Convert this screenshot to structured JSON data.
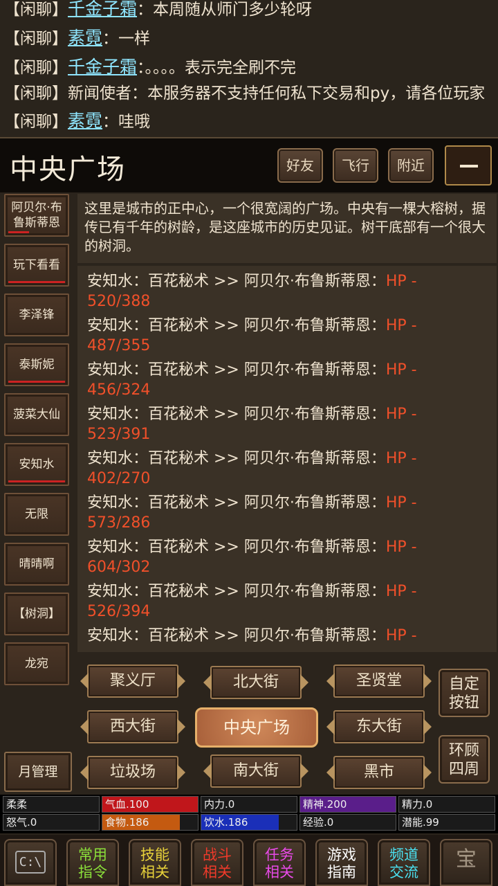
{
  "chat": [
    {
      "channel": "【闲聊】",
      "name": "千金子霜",
      "sep": "：",
      "text": "本周随从师门多少轮呀"
    },
    {
      "channel": "【闲聊】",
      "name": "素霓",
      "sep": "：",
      "text": "一样"
    },
    {
      "channel": "【闲聊】",
      "name": "千金子霜",
      "sep": "：",
      "text": "。。。。表示完全刷不完"
    },
    {
      "channel": "【闲聊】",
      "name": "",
      "sep": "",
      "text": "新闻使者：本服务器不支持任何私下交易和py，请各位玩家"
    },
    {
      "channel": "【闲聊】",
      "name": "素霓",
      "sep": "：",
      "text": "哇哦"
    }
  ],
  "room": {
    "title": "中央广场",
    "buttons": [
      "好友",
      "飞行",
      "附近"
    ],
    "menu_icon": "hamburger-icon",
    "description": "这里是城市的正中心，一个很宽阔的广场。中央有一棵大榕树，据传已有千年的树龄，是这座城市的历史见证。树干底部有一个很大的树洞。"
  },
  "players": [
    {
      "name": "阿贝尔·布鲁斯蒂恩",
      "hp": 0.35
    },
    {
      "name": "玩下看看",
      "hp": 0.95
    },
    {
      "name": "李泽锋",
      "hp": null
    },
    {
      "name": "泰斯妮",
      "hp": 0.95
    },
    {
      "name": "菠菜大仙",
      "hp": null
    },
    {
      "name": "安知水",
      "hp": 0.95
    },
    {
      "name": "无限",
      "hp": null
    },
    {
      "name": "晴晴啊",
      "hp": null
    },
    {
      "name": "【树洞】",
      "hp": null
    },
    {
      "name": "龙宛",
      "hp": null
    }
  ],
  "battle_log": [
    {
      "text": "安知水：百花秘术 >> 阿贝尔·布鲁斯蒂恩：",
      "hp_label": "HP -",
      "hp_value": "520/388"
    },
    {
      "text": "安知水：百花秘术 >> 阿贝尔·布鲁斯蒂恩：",
      "hp_label": "HP -",
      "hp_value": "487/355"
    },
    {
      "text": "安知水：百花秘术 >> 阿贝尔·布鲁斯蒂恩：",
      "hp_label": "HP -",
      "hp_value": "456/324"
    },
    {
      "text": "安知水：百花秘术 >> 阿贝尔·布鲁斯蒂恩：",
      "hp_label": "HP -",
      "hp_value": "523/391"
    },
    {
      "text": "安知水：百花秘术 >> 阿贝尔·布鲁斯蒂恩：",
      "hp_label": "HP -",
      "hp_value": "402/270"
    },
    {
      "text": "安知水：百花秘术 >> 阿贝尔·布鲁斯蒂恩：",
      "hp_label": "HP -",
      "hp_value": "573/286"
    },
    {
      "text": "安知水：百花秘术 >> 阿贝尔·布鲁斯蒂恩：",
      "hp_label": "HP -",
      "hp_value": "604/302"
    },
    {
      "text": "安知水：百花秘术 >> 阿贝尔·布鲁斯蒂恩：",
      "hp_label": "HP -",
      "hp_value": "526/394"
    },
    {
      "text": "安知水：百花秘术 >> 阿贝尔·布鲁斯蒂恩：",
      "hp_label": "HP -",
      "hp_value": ""
    }
  ],
  "nav": {
    "juyiting": "聚义厅",
    "beidajie": "北大街",
    "shengxiantang": "圣贤堂",
    "xidajie": "西大街",
    "center": "中央广场",
    "dongdajie": "东大街",
    "lajichang": "垃圾场",
    "nandajie": "南大街",
    "heishi": "黑市",
    "custom_button": [
      "自定",
      "按钮"
    ],
    "look_around": [
      "环顾",
      "四周"
    ],
    "month_manage": "月管理"
  },
  "stats": {
    "name": "柔柔",
    "qixue": "气血.100",
    "neili": "内力.0",
    "jingshen": "精神.200",
    "jingli": "精力.0",
    "nuqi": "怒气.0",
    "shiwu": "食物.186",
    "yinshui": "饮水.186",
    "jingyan": "经验.0",
    "qianneng": "潜能.99",
    "qixue_fill": 1.0,
    "jingshen_fill": 1.0,
    "shiwu_fill": 0.81,
    "yinshui_fill": 0.81,
    "colors": {
      "qixue": "#c0161b",
      "jingshen": "#5a1e8a",
      "shiwu": "#c45a10",
      "yinshui": "#1a2fb8"
    }
  },
  "toolbar": [
    {
      "icon": "terminal-icon",
      "label": [
        "C:\\",
        ""
      ],
      "color": "#cfcfcf"
    },
    {
      "label": [
        "常用",
        "指令"
      ],
      "color": "#8be03a"
    },
    {
      "label": [
        "技能",
        "相关"
      ],
      "color": "#e8d23a"
    },
    {
      "label": [
        "战斗",
        "相关"
      ],
      "color": "#f03a2a"
    },
    {
      "label": [
        "任务",
        "相关"
      ],
      "color": "#e84ae8"
    },
    {
      "label": [
        "游戏",
        "指南"
      ],
      "color": "#ffffff"
    },
    {
      "label": [
        "频道",
        "交流"
      ],
      "color": "#4ae0f0"
    },
    {
      "icon": "treasure-icon",
      "label": [
        "宝",
        ""
      ],
      "color": "#d8b070"
    }
  ]
}
